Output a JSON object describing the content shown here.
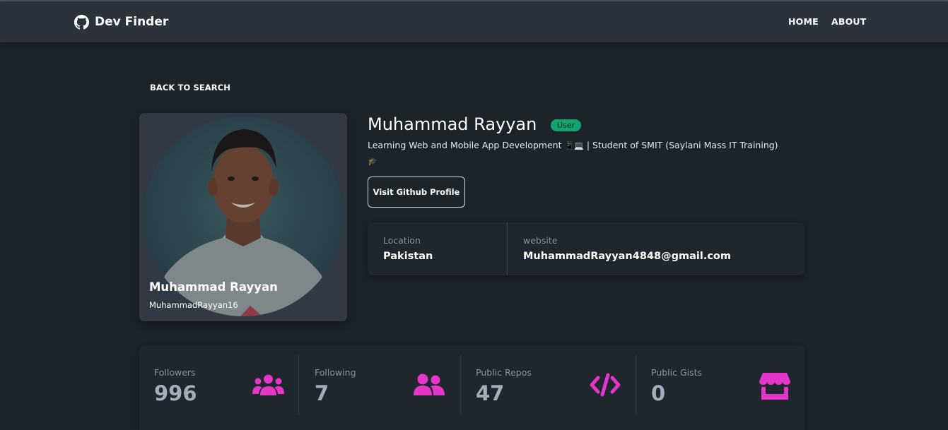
{
  "navbar": {
    "brand": "Dev Finder",
    "links": [
      "HOME",
      "ABOUT"
    ]
  },
  "back_label": "BACK TO SEARCH",
  "profile": {
    "name": "Muhammad Rayyan",
    "login": "MuhammadRayyan16",
    "type": "User",
    "bio_text": "Learning Web and Mobile App Development",
    "bio_emoji_1": "📱💻",
    "bio_rest": " | Student of SMIT (Saylani Mass IT Training)",
    "bio_emoji_2": "🎓",
    "visit_label": "Visit Github Profile"
  },
  "info": {
    "location_label": "Location",
    "location_value": "Pakistan",
    "website_label": "website",
    "website_value": "MuhammadRayyan4848@gmail.com"
  },
  "stats": [
    {
      "label": "Followers",
      "value": "996",
      "icon": "users-icon"
    },
    {
      "label": "Following",
      "value": "7",
      "icon": "user-friends-icon"
    },
    {
      "label": "Public Repos",
      "value": "47",
      "icon": "code-icon"
    },
    {
      "label": "Public Gists",
      "value": "0",
      "icon": "store-icon"
    }
  ],
  "colors": {
    "background": "#1d232a",
    "navbar": "#2a323c",
    "badge": "#12a46e",
    "stat_icon": "#e536c9"
  }
}
